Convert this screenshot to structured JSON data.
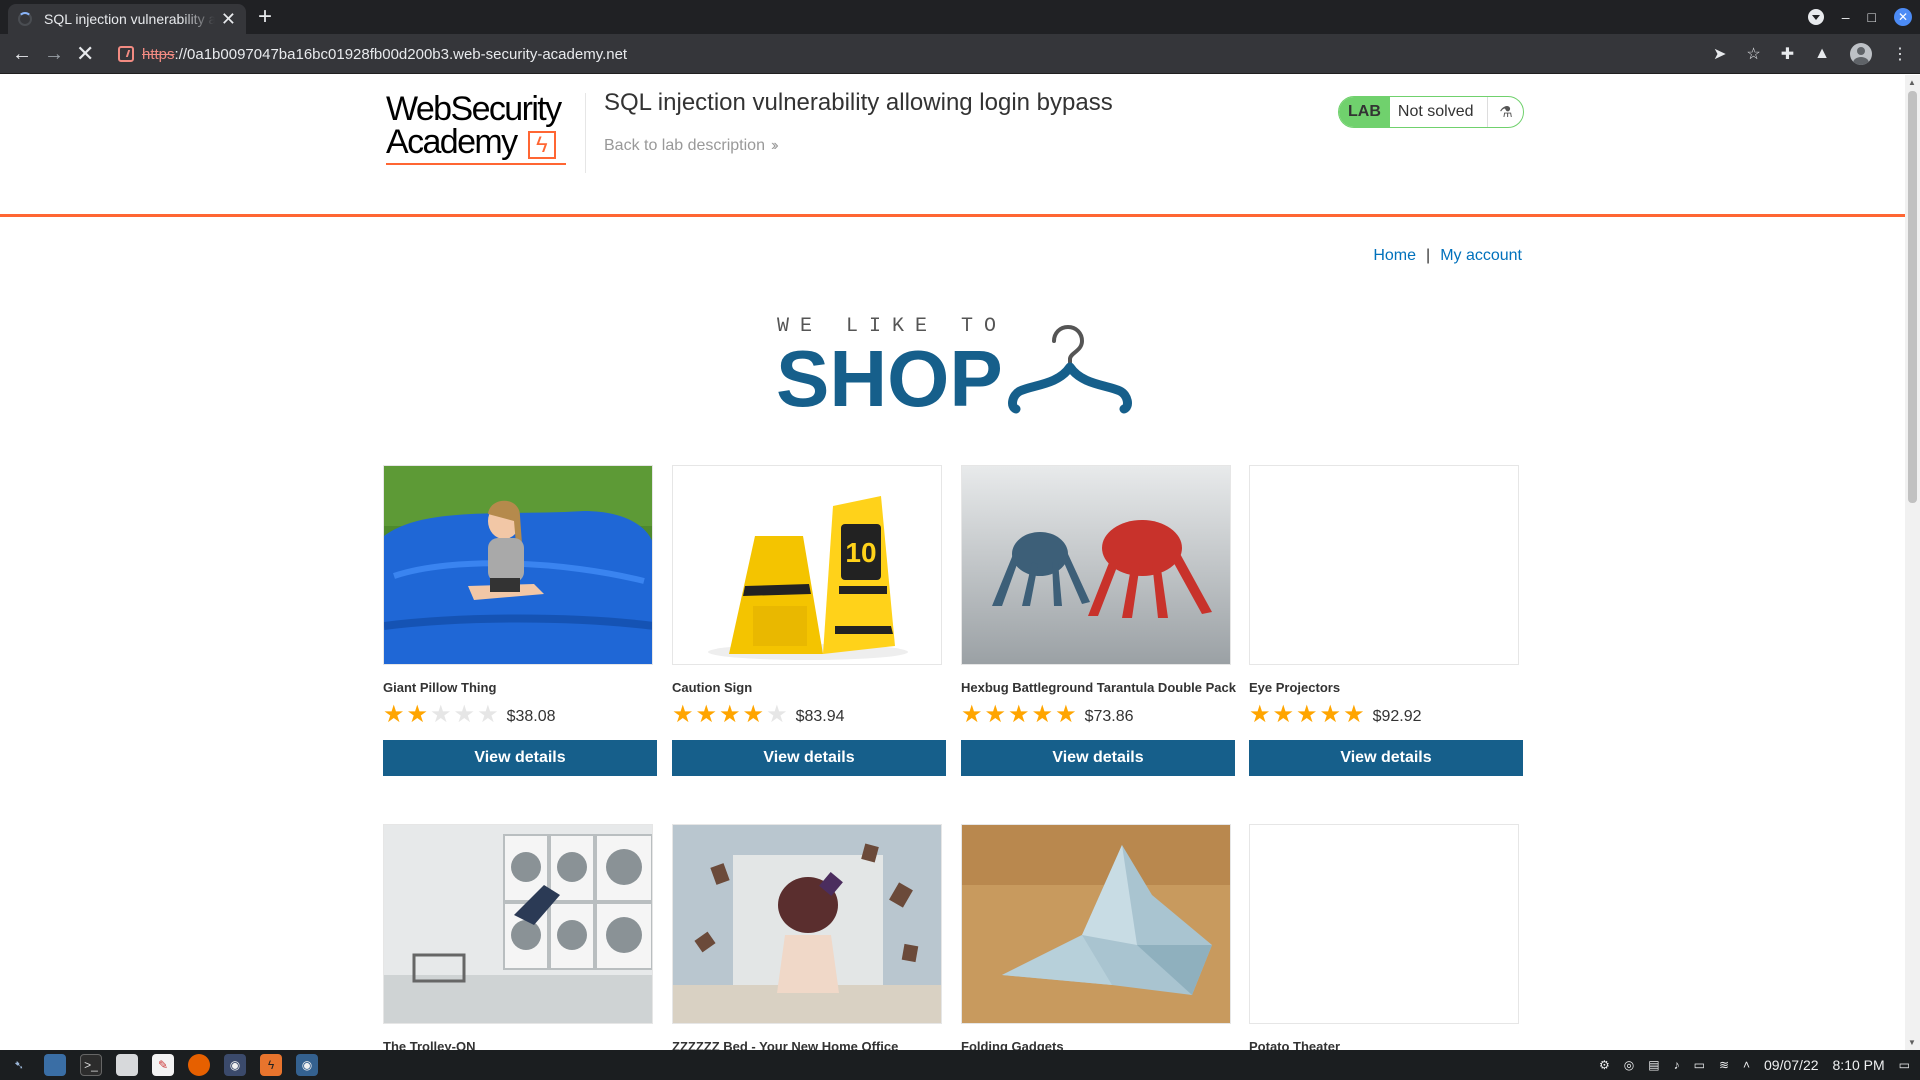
{
  "browser": {
    "tab_title": "SQL injection vulnerability allowing login bypass",
    "new_tab": "+",
    "tab_close": "✕",
    "url_scheme": "https",
    "url_rest": "://0a1b0097047ba16bc01928fb00d200b3.web-security-academy.net"
  },
  "lab_header": {
    "logo_line1": "WebSecurity",
    "logo_line2": "Academy",
    "title": "SQL injection vulnerability allowing login bypass",
    "back_link": "Back to lab description",
    "status_tag": "LAB",
    "status_text": "Not solved"
  },
  "nav": {
    "home": "Home",
    "separator": "|",
    "my_account": "My account"
  },
  "banner": {
    "tagline": "WE LIKE TO",
    "headline": "SHOP"
  },
  "products": [
    {
      "name": "Giant Pillow Thing",
      "rating": 2,
      "price": "$38.08",
      "button": "View details",
      "image": "bean-bag"
    },
    {
      "name": "Caution Sign",
      "rating": 4,
      "price": "$83.94",
      "button": "View details",
      "image": "caution-sign"
    },
    {
      "name": "Hexbug Battleground Tarantula Double Pack",
      "rating": 5,
      "price": "$73.86",
      "button": "View details",
      "image": "robot-spiders"
    },
    {
      "name": "Eye Projectors",
      "rating": 5,
      "price": "$92.92",
      "button": "View details",
      "image": "blank"
    },
    {
      "name": "The Trolley-ON",
      "image": "laundromat"
    },
    {
      "name": "ZZZZZZ Bed - Your New Home Office",
      "image": "bed-books"
    },
    {
      "name": "Folding Gadgets",
      "image": "origami"
    },
    {
      "name": "Potato Theater",
      "image": "blank"
    }
  ],
  "taskbar": {
    "date": "09/07/22",
    "time": "8:10 PM"
  },
  "colors": {
    "accent_orange": "#ff6633",
    "brand_blue": "#165f8b",
    "link_blue": "#0071bc",
    "lab_green": "#70d16d",
    "star": "#ffa500"
  }
}
